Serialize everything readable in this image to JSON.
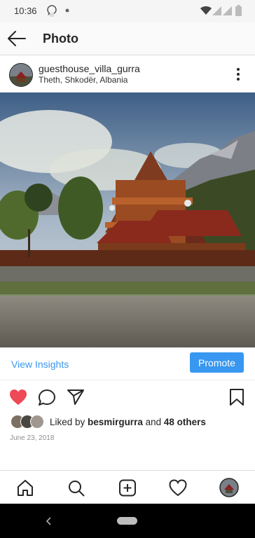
{
  "status_bar": {
    "time": "10:36"
  },
  "header": {
    "title": "Photo"
  },
  "post": {
    "username": "guesthouse_villa_gurra",
    "location": "Theth, Shkodër, Albania"
  },
  "insights": {
    "link_label": "View Insights",
    "promote_label": "Promote"
  },
  "likes": {
    "prefix": "Liked by ",
    "user": "besmirgurra",
    "connector": " and ",
    "others": "48 others",
    "liked": true
  },
  "date": "June 23, 2018",
  "colors": {
    "accent": "#3897f0",
    "like_red": "#ed4956",
    "text": "#262626",
    "muted": "#8e8e8e"
  },
  "icons": {
    "back": "arrow-left-icon",
    "more": "vertical-dots-icon",
    "like": "heart-icon",
    "comment": "comment-bubble-icon",
    "share": "paper-plane-icon",
    "save": "bookmark-icon",
    "home": "home-icon",
    "search": "search-icon",
    "new_post": "plus-square-icon",
    "activity": "heart-outline-icon",
    "profile": "profile-avatar-icon",
    "system_back": "chevron-left-icon",
    "system_home": "home-pill-icon"
  }
}
